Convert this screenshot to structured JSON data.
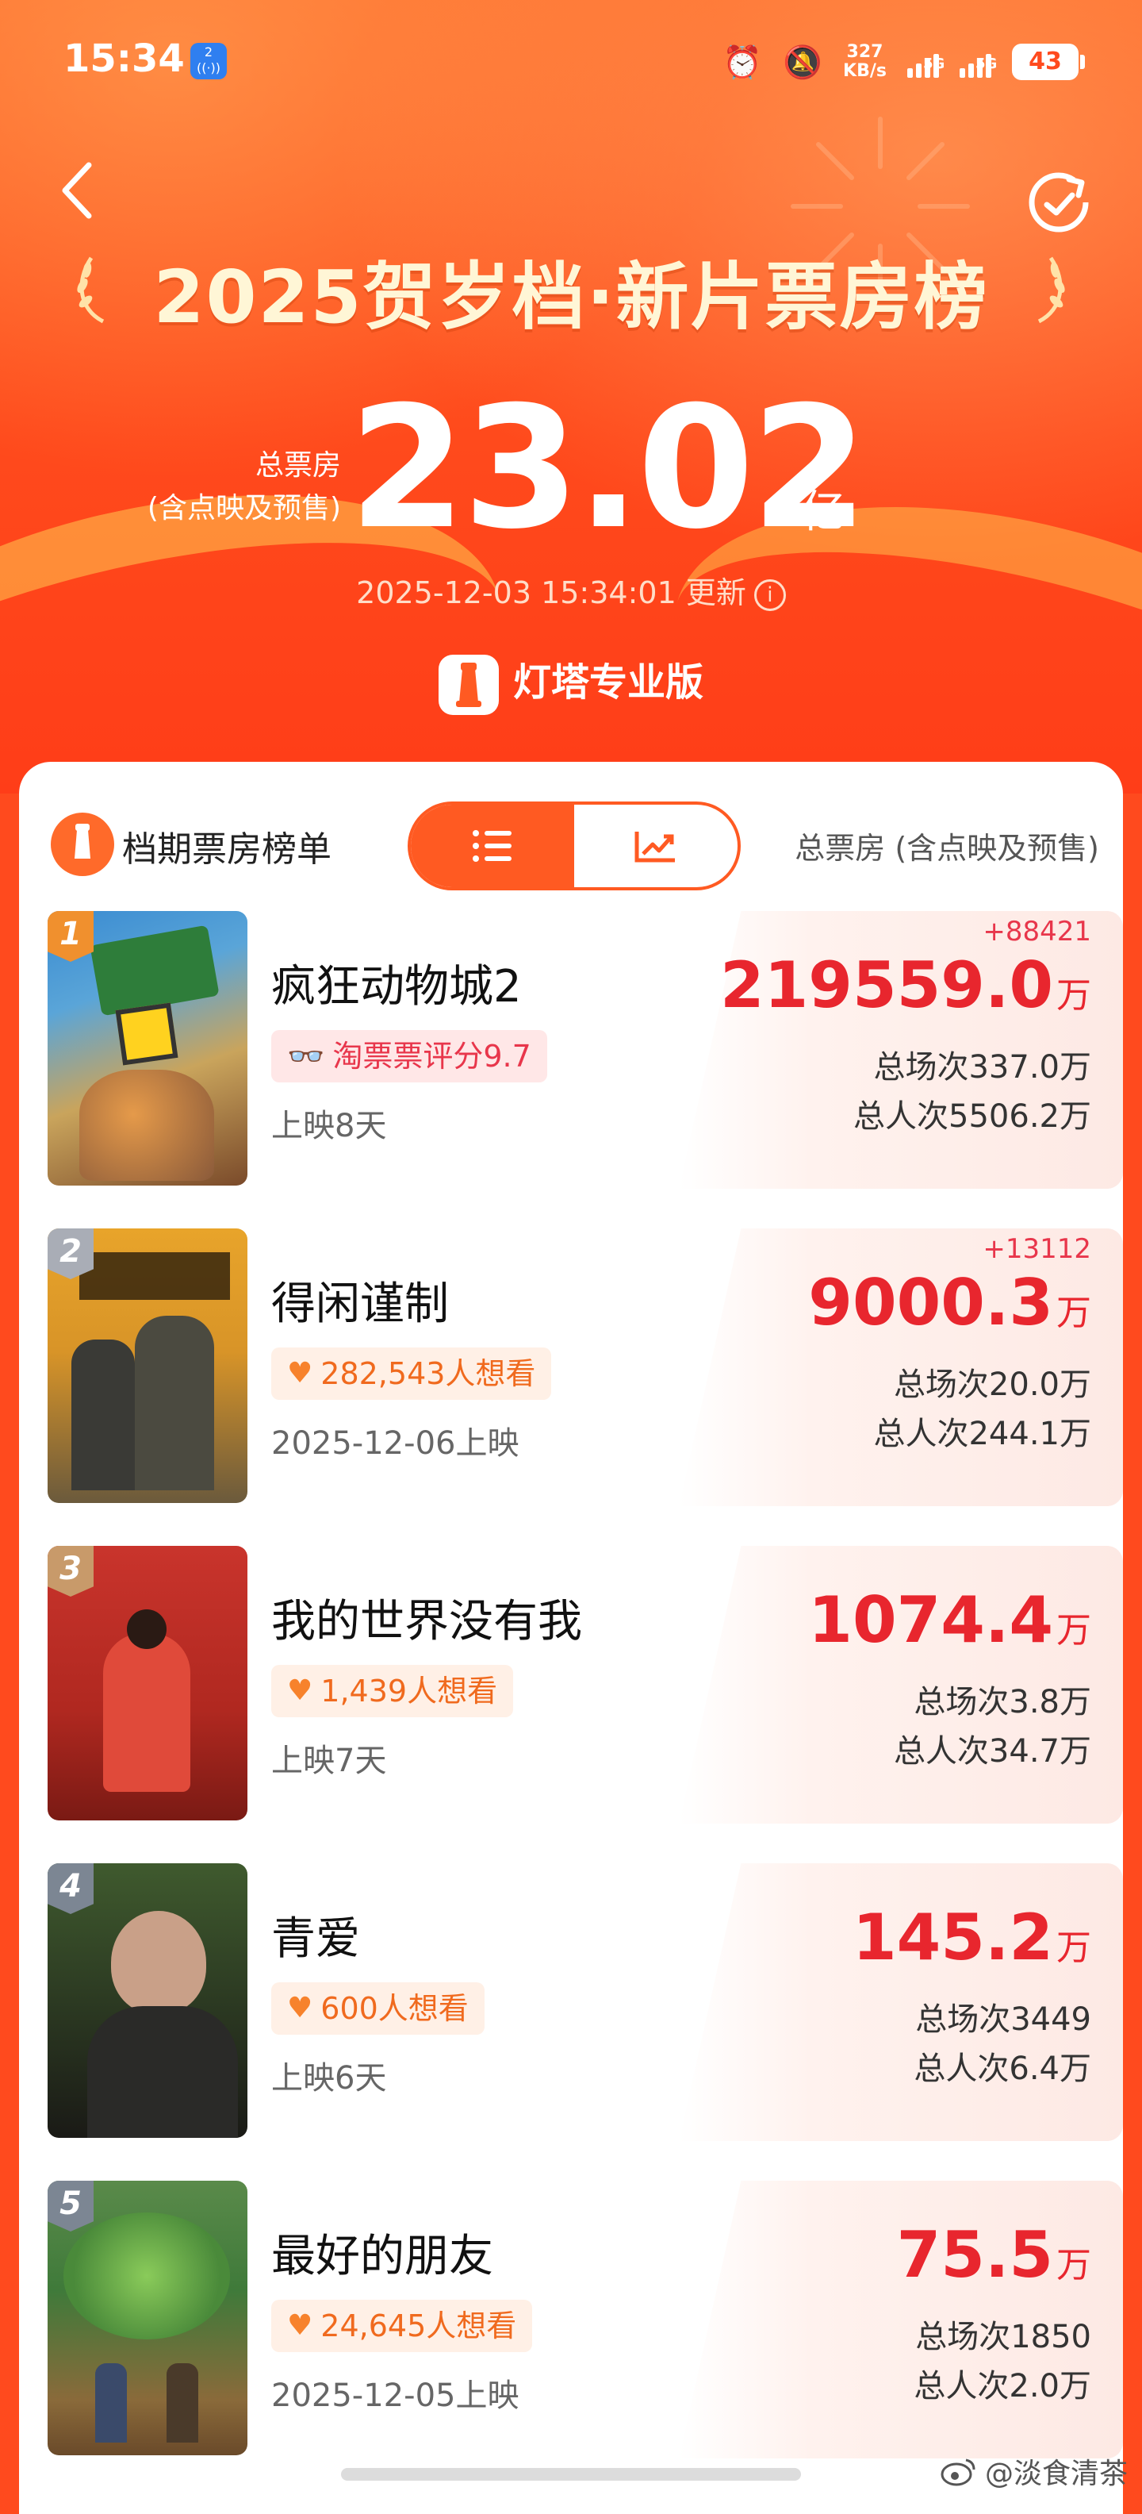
{
  "status_bar": {
    "time": "15:34",
    "badge": "2",
    "speed_value": "327",
    "speed_unit": "KB/s",
    "sim1": "5G",
    "sim2": "5G",
    "battery": "43"
  },
  "header": {
    "title": "2025贺岁档·新片票房榜",
    "total_label_line1": "总票房",
    "total_label_line2": "(含点映及预售)",
    "total_value": "23.02",
    "total_unit": "亿",
    "update_time": "2025-12-03 15:34:01 更新",
    "brand": "灯塔专业版"
  },
  "list_header": {
    "title": "档期票房榜单",
    "right_label": "总票房 (含点映及预售)"
  },
  "movies": [
    {
      "rank": "1",
      "title": "疯狂动物城2",
      "tag_text": "淘票票评分9.7",
      "tag_type": "rating",
      "sub": "上映8天",
      "delta": "+88421",
      "box": "219559.0",
      "unit": "万",
      "screenings": "总场次337.0万",
      "admissions": "总人次5506.2万"
    },
    {
      "rank": "2",
      "title": "得闲谨制",
      "tag_text": "282,543人想看",
      "tag_type": "want",
      "sub": "2025-12-06上映",
      "delta": "+13112",
      "box": "9000.3",
      "unit": "万",
      "screenings": "总场次20.0万",
      "admissions": "总人次244.1万"
    },
    {
      "rank": "3",
      "title": "我的世界没有我",
      "tag_text": "1,439人想看",
      "tag_type": "want",
      "sub": "上映7天",
      "delta": "",
      "box": "1074.4",
      "unit": "万",
      "screenings": "总场次3.8万",
      "admissions": "总人次34.7万"
    },
    {
      "rank": "4",
      "title": "青爱",
      "tag_text": "600人想看",
      "tag_type": "want",
      "sub": "上映6天",
      "delta": "",
      "box": "145.2",
      "unit": "万",
      "screenings": "总场次3449",
      "admissions": "总人次6.4万"
    },
    {
      "rank": "5",
      "title": "最好的朋友",
      "tag_text": "24,645人想看",
      "tag_type": "want",
      "sub": "2025-12-05上映",
      "delta": "",
      "box": "75.5",
      "unit": "万",
      "screenings": "总场次1850",
      "admissions": "总人次2.0万"
    }
  ],
  "watermark": "@淡食清茶",
  "colors": {
    "accent": "#ff5a22",
    "price_red": "#e8262e"
  }
}
